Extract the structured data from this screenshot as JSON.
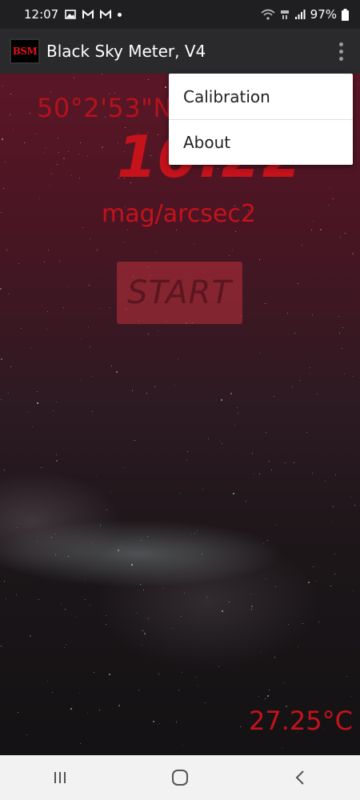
{
  "status_bar": {
    "time": "12:07",
    "battery": "97%"
  },
  "app_bar": {
    "logo_text": "BSM",
    "title": "Black Sky Meter, V4"
  },
  "main": {
    "coordinates": "50°2'53\"N",
    "reading": "10.22",
    "unit": "mag/arcsec2",
    "start_label": "START",
    "temperature": "27.25°C"
  },
  "menu": {
    "items": [
      {
        "label": "Calibration"
      },
      {
        "label": "About"
      }
    ]
  },
  "icons": {
    "status_left": [
      "gallery-icon",
      "gmail-icon",
      "gmail-icon",
      "notification-dot-icon"
    ],
    "status_right": [
      "wifi-icon",
      "4g-icon",
      "signal-icon",
      "battery-icon"
    ],
    "nav": [
      "recent-apps-icon",
      "home-icon",
      "back-icon"
    ]
  },
  "colors": {
    "accent_red": "#c5121b",
    "app_bar": "#2a2a2c"
  }
}
